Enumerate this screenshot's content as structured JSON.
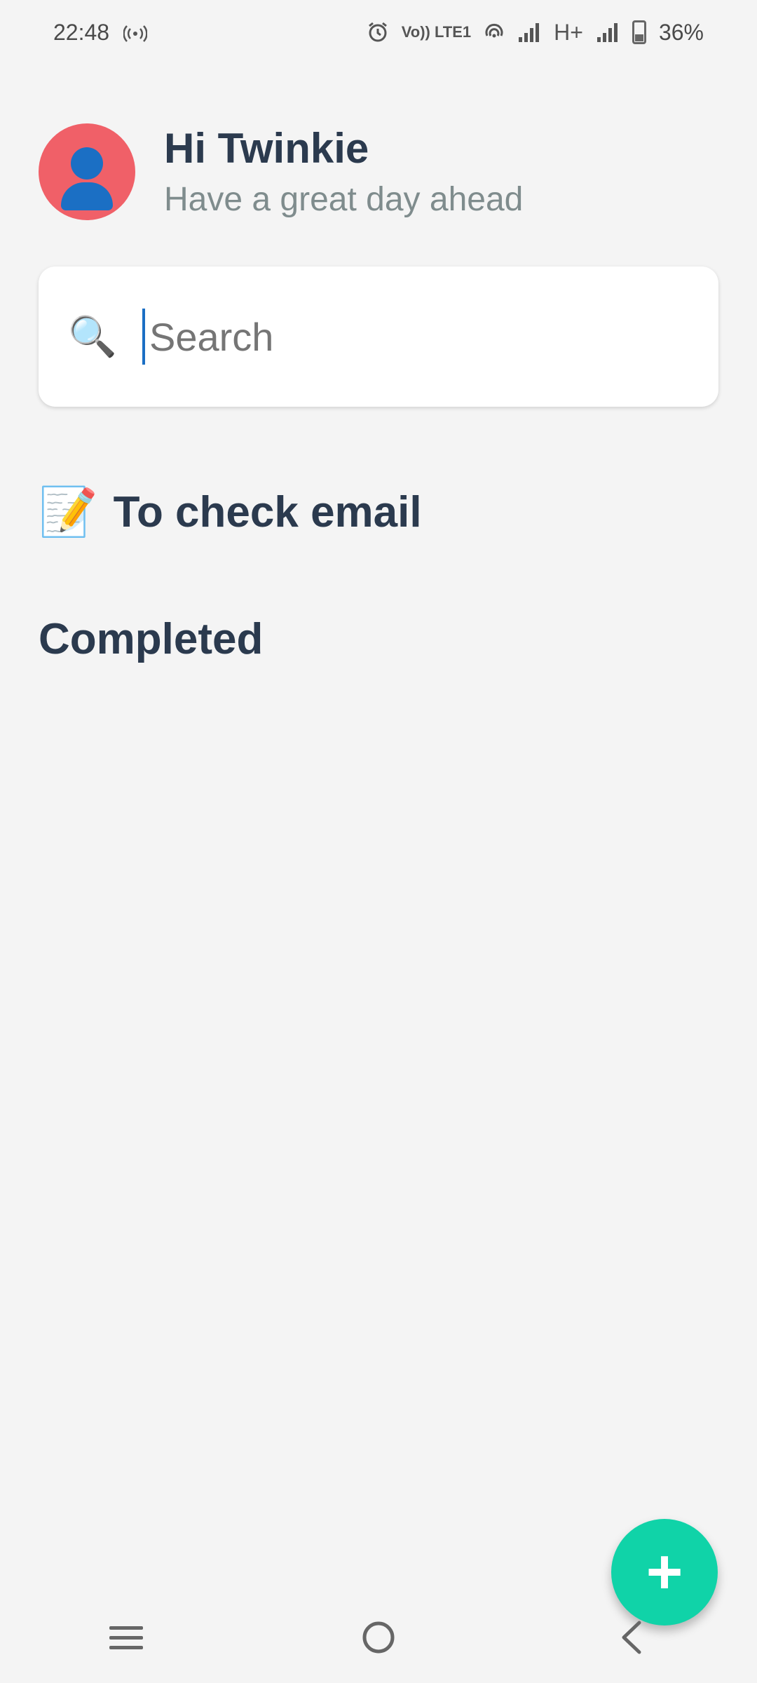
{
  "status_bar": {
    "time": "22:48",
    "battery_percent": "36%",
    "icons": [
      "hotspot-icon",
      "alarm-icon",
      "volte-icon",
      "wifi-calling-icon",
      "signal-icon",
      "h-plus-icon",
      "signal-icon",
      "battery-icon"
    ],
    "volte_label": "Vo)) LTE1",
    "network_label": "H+"
  },
  "header": {
    "greeting": "Hi Twinkie",
    "subtitle": "Have a great day ahead",
    "avatar_color": "#f06068"
  },
  "search": {
    "placeholder": "Search",
    "value": ""
  },
  "tasks": [
    {
      "icon": "📝",
      "label": "To check email"
    }
  ],
  "completed_section": {
    "title": "Completed"
  },
  "fab": {
    "label": "+",
    "color": "#10d3a8"
  },
  "nav_bar": {
    "items": [
      "menu-icon",
      "home-icon",
      "back-icon"
    ]
  }
}
